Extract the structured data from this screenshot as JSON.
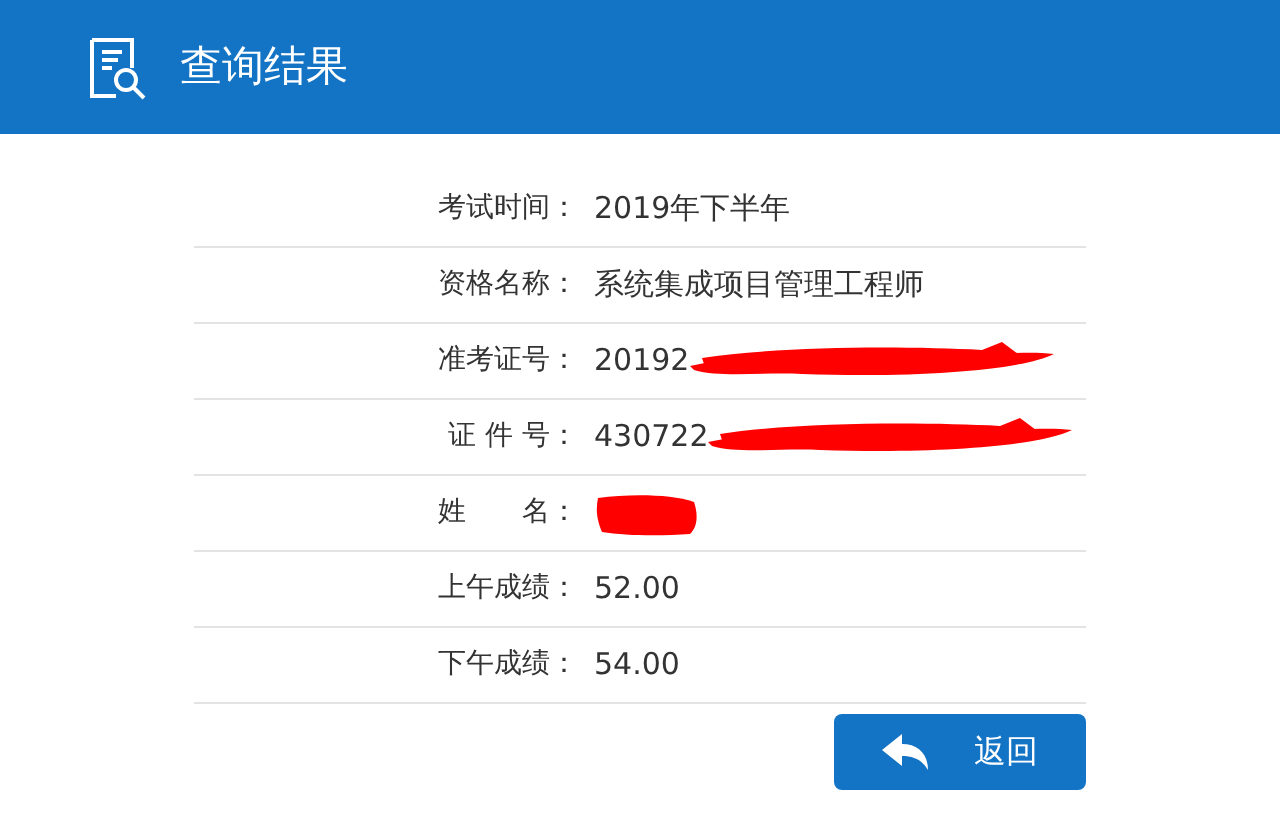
{
  "header": {
    "title": "查询结果"
  },
  "rows": [
    {
      "label": "考试时间：",
      "value": "2019年下半年",
      "redacted": false
    },
    {
      "label": "资格名称：",
      "value": "系统集成项目管理工程师",
      "redacted": false
    },
    {
      "label": "准考证号：",
      "value": "20192",
      "redacted": true
    },
    {
      "label": "证 件 号：",
      "value": "430722",
      "redacted": true
    },
    {
      "label": "姓　　名：",
      "redacted": true
    },
    {
      "label": "上午成绩：",
      "value": "52.00",
      "redacted": false
    },
    {
      "label": "下午成绩：",
      "value": "54.00",
      "redacted": false
    }
  ],
  "back_button": {
    "label": "返回"
  }
}
